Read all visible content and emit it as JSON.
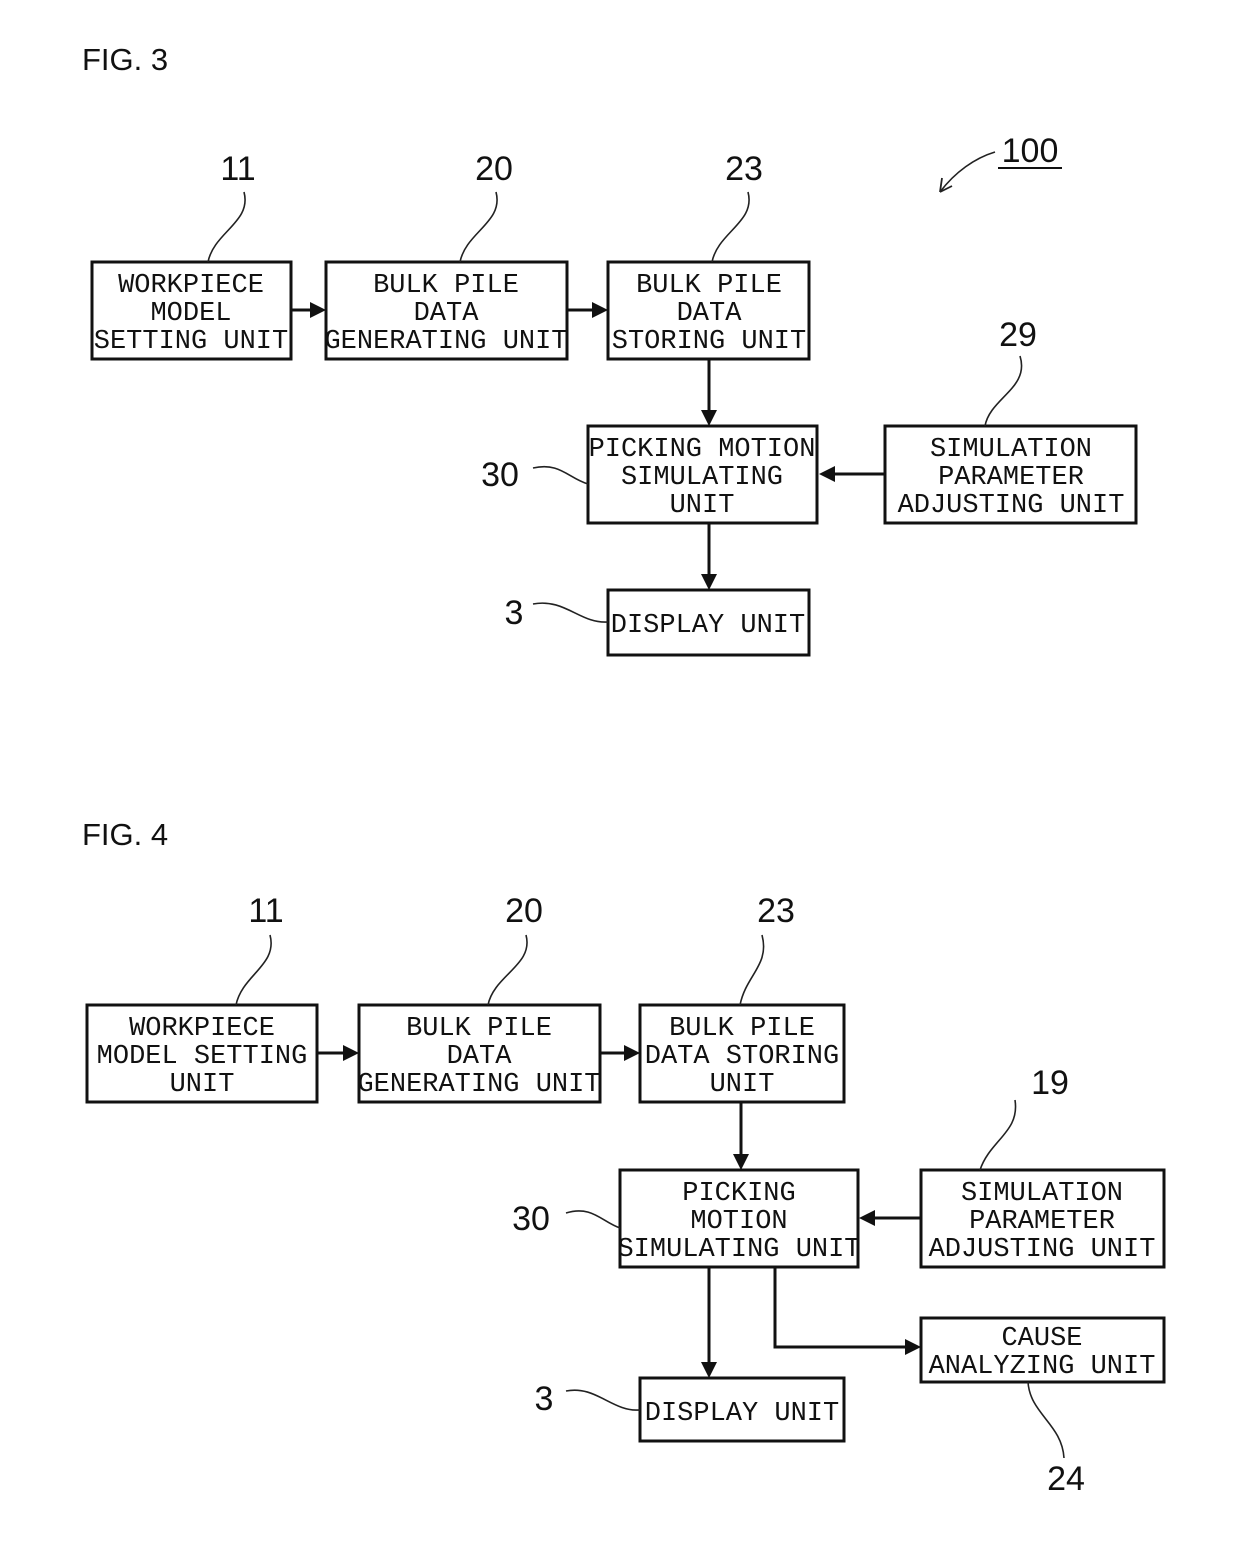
{
  "figures": [
    {
      "title": "FIG. 3",
      "system_ref": "100",
      "blocks": [
        {
          "id": "wm",
          "ref": "11",
          "lines": [
            "WORKPIECE",
            "MODEL",
            "SETTING UNIT"
          ]
        },
        {
          "id": "bg",
          "ref": "20",
          "lines": [
            "BULK PILE",
            "DATA",
            "GENERATING UNIT"
          ]
        },
        {
          "id": "bs",
          "ref": "23",
          "lines": [
            "BULK PILE",
            "DATA",
            "STORING UNIT"
          ]
        },
        {
          "id": "sp",
          "ref": "29",
          "lines": [
            "SIMULATION",
            "PARAMETER",
            "ADJUSTING UNIT"
          ]
        },
        {
          "id": "pm",
          "ref": "30",
          "lines": [
            "PICKING MOTION",
            "SIMULATING",
            "UNIT"
          ]
        },
        {
          "id": "du",
          "ref": "3",
          "lines": [
            "DISPLAY UNIT"
          ]
        }
      ],
      "connections": [
        {
          "from": "wm",
          "to": "bg"
        },
        {
          "from": "bg",
          "to": "bs"
        },
        {
          "from": "bs",
          "to": "pm"
        },
        {
          "from": "sp",
          "to": "pm"
        },
        {
          "from": "pm",
          "to": "du"
        }
      ]
    },
    {
      "title": "FIG. 4",
      "blocks": [
        {
          "id": "wm",
          "ref": "11",
          "lines": [
            "WORKPIECE",
            "MODEL SETTING",
            "UNIT"
          ]
        },
        {
          "id": "bg",
          "ref": "20",
          "lines": [
            "BULK PILE",
            "DATA",
            "GENERATING UNIT"
          ]
        },
        {
          "id": "bs",
          "ref": "23",
          "lines": [
            "BULK PILE",
            "DATA STORING",
            "UNIT"
          ]
        },
        {
          "id": "sp",
          "ref": "19",
          "lines": [
            "SIMULATION",
            "PARAMETER",
            "ADJUSTING UNIT"
          ]
        },
        {
          "id": "pm",
          "ref": "30",
          "lines": [
            "PICKING",
            "MOTION",
            "SIMULATING UNIT"
          ]
        },
        {
          "id": "du",
          "ref": "3",
          "lines": [
            "DISPLAY UNIT"
          ]
        },
        {
          "id": "ca",
          "ref": "24",
          "lines": [
            "CAUSE",
            "ANALYZING UNIT"
          ]
        }
      ],
      "connections": [
        {
          "from": "wm",
          "to": "bg"
        },
        {
          "from": "bg",
          "to": "bs"
        },
        {
          "from": "bs",
          "to": "pm"
        },
        {
          "from": "sp",
          "to": "pm"
        },
        {
          "from": "pm",
          "to": "du"
        },
        {
          "from": "pm",
          "to": "ca"
        }
      ]
    }
  ]
}
